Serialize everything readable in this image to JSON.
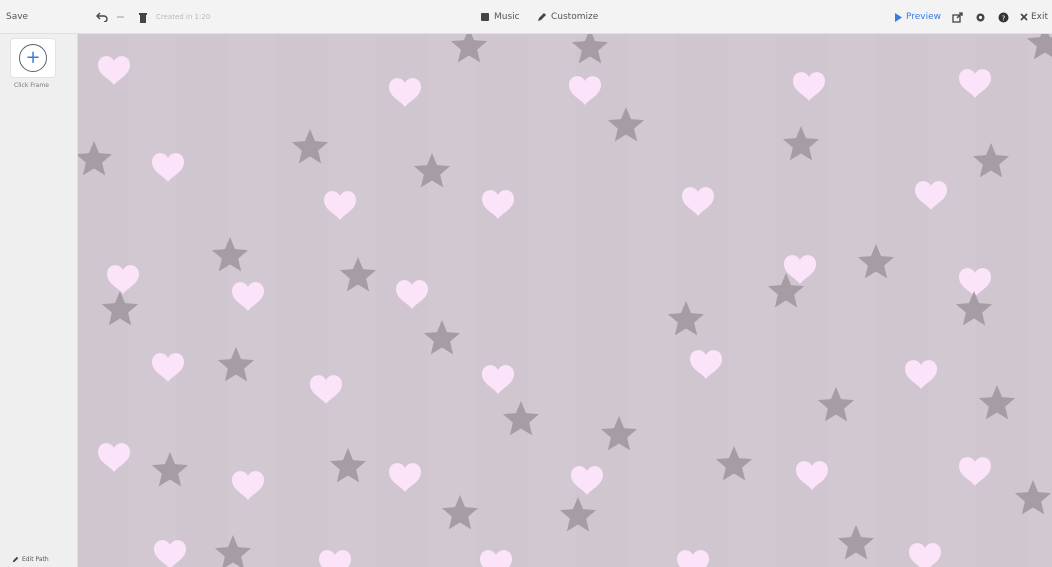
{
  "app": {
    "title": "Save"
  },
  "toolbar": {
    "undo_icon": "undo-icon",
    "redo_icon": "redo-icon",
    "trash_icon": "trash-icon",
    "hidden_text": "Created in 1:20",
    "music_label": "Music",
    "customize_label": "Customize",
    "preview_label": "Preview",
    "close_label": "Exit"
  },
  "sidebar": {
    "add_label": "Click Frame",
    "add_icon": "plus-icon",
    "bottom_label": "Edit Path"
  },
  "canvas": {
    "background": "#cfc6cf",
    "heart_color": "#fbe4f9",
    "star_color": "#a59ca6",
    "pattern": "hearts-and-stars"
  }
}
